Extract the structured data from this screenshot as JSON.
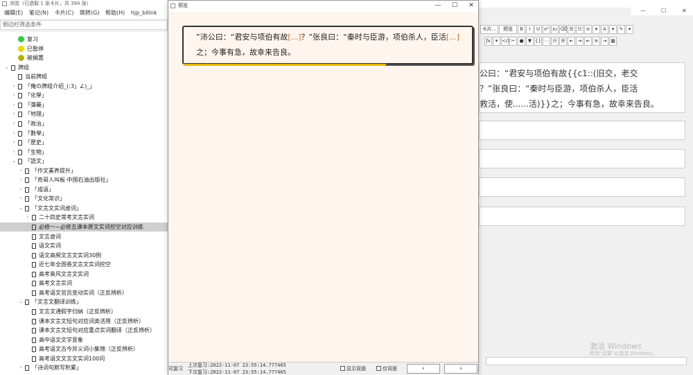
{
  "main": {
    "title": "浏览（已选取 1 张卡片，共 394 张）",
    "menu": [
      "编辑(E)",
      "笔记(N)",
      "卡片(C)",
      "跳转(G)",
      "帮助(H)",
      "hjp_bilink"
    ],
    "search_placeholder": "侧边栏筛选条件"
  },
  "tree": [
    {
      "depth": 0,
      "kind": "dot",
      "color": "#2ecc40",
      "label": "复习"
    },
    {
      "depth": 0,
      "kind": "dot",
      "color": "#e6d800",
      "label": "已暂停"
    },
    {
      "depth": 0,
      "kind": "dot",
      "color": "#b5b000",
      "label": "被搁置"
    },
    {
      "depth": 0,
      "kind": "deck",
      "arrow": "v",
      "label": "牌组"
    },
    {
      "depth": 1,
      "kind": "deck",
      "arrow": "",
      "label": "当前牌组"
    },
    {
      "depth": 1,
      "kind": "deck",
      "arrow": ">",
      "label": "「俺の牌组介绍_(:3」∠)_」"
    },
    {
      "depth": 1,
      "kind": "deck",
      "arrow": ">",
      "label": "「化學」"
    },
    {
      "depth": 1,
      "kind": "deck",
      "arrow": ">",
      "label": "「彈藥」"
    },
    {
      "depth": 1,
      "kind": "deck",
      "arrow": ">",
      "label": "「地理」"
    },
    {
      "depth": 1,
      "kind": "deck",
      "arrow": ">",
      "label": "「政治」"
    },
    {
      "depth": 1,
      "kind": "deck",
      "arrow": ">",
      "label": "「數學」"
    },
    {
      "depth": 1,
      "kind": "deck",
      "arrow": ">",
      "label": "「歷史」"
    },
    {
      "depth": 1,
      "kind": "deck",
      "arrow": ">",
      "label": "「生物」"
    },
    {
      "depth": 1,
      "kind": "deck",
      "arrow": "v",
      "label": "「語文」"
    },
    {
      "depth": 2,
      "kind": "deck",
      "arrow": ">",
      "label": "「作文素养提升」"
    },
    {
      "depth": 2,
      "kind": "deck",
      "arrow": ">",
      "label": "「奇哥人叫板·中国石油出版社」"
    },
    {
      "depth": 2,
      "kind": "deck",
      "arrow": ">",
      "label": "「成语」"
    },
    {
      "depth": 2,
      "kind": "deck",
      "arrow": ">",
      "label": "「文化常识」"
    },
    {
      "depth": 2,
      "kind": "deck",
      "arrow": "v",
      "label": "「文言文实词虚词」"
    },
    {
      "depth": 3,
      "kind": "deck",
      "arrow": ">",
      "label": "二十四史常考文言实词"
    },
    {
      "depth": 3,
      "kind": "deck",
      "arrow": "",
      "label": "必修一~必修五课本原文实词挖空对应训练",
      "selected": true
    },
    {
      "depth": 3,
      "kind": "deck",
      "arrow": "",
      "label": "文言虚词"
    },
    {
      "depth": 3,
      "kind": "deck",
      "arrow": "",
      "label": "语文实词"
    },
    {
      "depth": 3,
      "kind": "deck",
      "arrow": "",
      "label": "语文高频文言文实词30例"
    },
    {
      "depth": 3,
      "kind": "deck",
      "arrow": "",
      "label": "近七年全国卷文言文实词挖空"
    },
    {
      "depth": 3,
      "kind": "deck",
      "arrow": "",
      "label": "高考乘风文言文实词"
    },
    {
      "depth": 3,
      "kind": "deck",
      "arrow": "",
      "label": "高考文言实词"
    },
    {
      "depth": 3,
      "kind": "deck",
      "arrow": "",
      "label": "高考语文官员变动实词（正反辨析）"
    },
    {
      "depth": 2,
      "kind": "deck",
      "arrow": "v",
      "label": "「文言文翻译训练」"
    },
    {
      "depth": 3,
      "kind": "deck",
      "arrow": "",
      "label": "文言文通假字归纳（正反辨析）"
    },
    {
      "depth": 3,
      "kind": "deck",
      "arrow": "",
      "label": "课本文言文短句对应词类活用（正反辨析）"
    },
    {
      "depth": 3,
      "kind": "deck",
      "arrow": "",
      "label": "课本文言文短句对应重点实词翻译（正反辨析）"
    },
    {
      "depth": 3,
      "kind": "deck",
      "arrow": "",
      "label": "高中语文文学意象"
    },
    {
      "depth": 3,
      "kind": "deck",
      "arrow": "",
      "label": "高考语文古今异义词小集锦（正反辨析）"
    },
    {
      "depth": 3,
      "kind": "deck",
      "arrow": "",
      "label": "高考语文文言文实词100问"
    },
    {
      "depth": 2,
      "kind": "deck",
      "arrow": ">",
      "label": "「诗词句默写积累」"
    }
  ],
  "preview": {
    "title": "预览",
    "controls": [
      "—",
      "☐",
      "✕"
    ],
    "card": {
      "p1": "”沛公曰：“君安与项伯有故",
      "c1": "[...]",
      "p2": "？”张良曰：“秦时与臣游，项伯杀人，臣活",
      "c2": "[...]",
      "p3": "之；今事有急，故幸来告良。"
    },
    "bottom": {
      "can_review": "可复习",
      "last_review": "上次复习:2022-11-07 23:55:14.777465",
      "next_review": "下次复习:2022-11-07 23:55:14.777465",
      "show_both": "显示双面",
      "back_only": "仅背面",
      "prev": "‹",
      "next": "›"
    }
  },
  "editor": {
    "window_controls": [
      "—",
      "☐",
      "✕"
    ],
    "toolbar_row1": [
      "卡片...",
      "预览",
      "B",
      "I",
      "U",
      "x²",
      "x₂",
      "⌫",
      "☰",
      "☷",
      "≡",
      "▾",
      "A",
      "▾",
      "✎",
      "▾"
    ],
    "toolbar_row2": [
      "ƒx",
      "▾",
      "</>",
      "✂",
      "●",
      "▼",
      "{}",
      "⋯",
      "☷",
      "☰",
      "⇤",
      "⇥",
      "⇤",
      "≡",
      "⇥",
      "▦"
    ],
    "field_text_lines": [
      "公曰：“君安与项伯有故{{c1::(旧交，老交",
      "？”张良曰：“秦时与臣游，项伯杀人，臣活",
      "救活，使......活)}}之；今事有急，故幸来告良。"
    ],
    "watermark_title": "激活 Windows",
    "watermark_sub": "转到“设置”以激活 Windows。"
  }
}
